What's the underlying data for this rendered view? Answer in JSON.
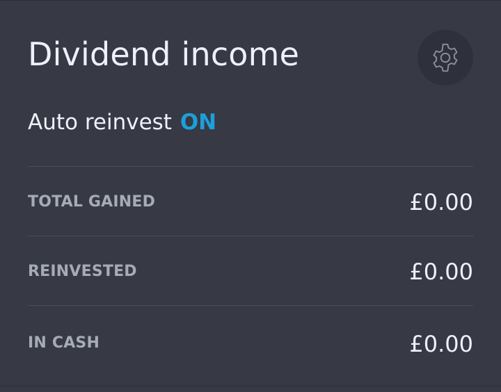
{
  "card": {
    "title": "Dividend income",
    "settings_icon": "gear-icon",
    "auto_reinvest": {
      "label": "Auto reinvest",
      "status": "ON",
      "status_color": "#1d9fd8"
    },
    "rows": [
      {
        "label": "TOTAL GAINED",
        "value": "£0.00"
      },
      {
        "label": "REINVESTED",
        "value": "£0.00"
      },
      {
        "label": "IN CASH",
        "value": "£0.00"
      }
    ]
  }
}
